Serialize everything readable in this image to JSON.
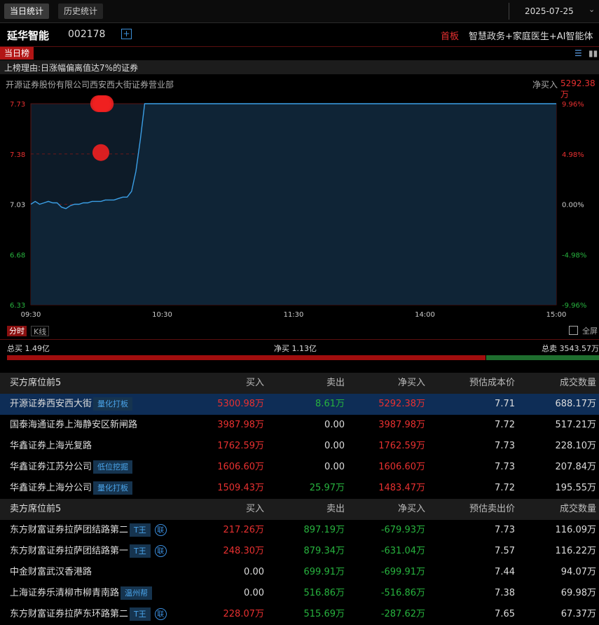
{
  "tabs": {
    "today": "当日统计",
    "history": "历史统计"
  },
  "date": "2025-07-25",
  "stock": {
    "name": "延华智能",
    "code": "002178",
    "add": "+",
    "first_board": "首板",
    "concepts": "智慧政务+家庭医生+AI智能体"
  },
  "board_tag": "当日榜",
  "reason": "上榜理由:日涨幅偏离值达7%的证券",
  "broker": "开源证券股份有限公司西安西大街证券营业部",
  "net_buy_label": "净买入",
  "net_buy_value": "5292.38万",
  "chart_data": {
    "type": "line",
    "title": "",
    "price_ticks": [
      "7.73",
      "7.38",
      "7.03",
      "6.68",
      "6.33"
    ],
    "pct_ticks": [
      "9.96%",
      "4.98%",
      "0.00%",
      "-4.98%",
      "-9.96%"
    ],
    "time_ticks": [
      "09:30",
      "10:30",
      "11:30",
      "14:00",
      "15:00"
    ],
    "ylim": [
      6.33,
      7.73
    ],
    "x_minutes": [
      0,
      2,
      4,
      6,
      8,
      10,
      12,
      14,
      16,
      18,
      20,
      22,
      24,
      26,
      28,
      30,
      32,
      34,
      36,
      38,
      40,
      42,
      44,
      46,
      48,
      50,
      52,
      54,
      56,
      58,
      60,
      240
    ],
    "prices": [
      7.03,
      7.05,
      7.03,
      7.04,
      7.05,
      7.04,
      7.04,
      7.01,
      7.0,
      7.02,
      7.03,
      7.03,
      7.04,
      7.04,
      7.05,
      7.05,
      7.05,
      7.06,
      7.06,
      7.06,
      7.07,
      7.08,
      7.08,
      7.12,
      7.26,
      7.48,
      7.73,
      7.73,
      7.73,
      7.73,
      7.73,
      7.73
    ],
    "markers": [
      {
        "x": 33,
        "price": 7.73
      },
      {
        "x": 32,
        "price": 7.73
      },
      {
        "x": 31,
        "price": 7.73
      },
      {
        "x": 34,
        "price": 7.73
      },
      {
        "x": 32,
        "price": 7.39
      }
    ]
  },
  "period_tabs": {
    "fenshi": "分时",
    "kline": "K线"
  },
  "fullscreen": "全屏",
  "summary": {
    "total_buy": "总买 1.49亿",
    "net": "净买 1.13亿",
    "total_sell": "总卖 3543.57万"
  },
  "ratio": {
    "buy_share": 0.808
  },
  "buy_table": {
    "headers": [
      "买方席位前5",
      "买入",
      "卖出",
      "净买入",
      "预估成本价",
      "成交数量"
    ],
    "rows": [
      {
        "name": "开源证券西安西大街",
        "tag": "量化打板",
        "buy": "5300.98万",
        "sell": "8.61万",
        "net": "5292.38万",
        "cost": "7.71",
        "vol": "688.17万"
      },
      {
        "name": "国泰海通证券上海静安区新闸路",
        "tag": "",
        "buy": "3987.98万",
        "sell": "0.00",
        "net": "3987.98万",
        "cost": "7.72",
        "vol": "517.21万"
      },
      {
        "name": "华鑫证券上海光复路",
        "tag": "",
        "buy": "1762.59万",
        "sell": "0.00",
        "net": "1762.59万",
        "cost": "7.73",
        "vol": "228.10万"
      },
      {
        "name": "华鑫证券江苏分公司",
        "tag": "低位挖掘",
        "buy": "1606.60万",
        "sell": "0.00",
        "net": "1606.60万",
        "cost": "7.73",
        "vol": "207.84万"
      },
      {
        "name": "华鑫证券上海分公司",
        "tag": "量化打板",
        "buy": "1509.43万",
        "sell": "25.97万",
        "net": "1483.47万",
        "cost": "7.72",
        "vol": "195.55万"
      }
    ]
  },
  "sell_table": {
    "headers": [
      "卖方席位前5",
      "买入",
      "卖出",
      "净买入",
      "预估卖出价",
      "成交数量"
    ],
    "rows": [
      {
        "name": "东方财富证券拉萨团结路第二",
        "tag": "T王",
        "lian": "联",
        "buy": "217.26万",
        "sell": "897.19万",
        "net": "-679.93万",
        "cost": "7.73",
        "vol": "116.09万"
      },
      {
        "name": "东方财富证券拉萨团结路第一",
        "tag": "T王",
        "lian": "联",
        "buy": "248.30万",
        "sell": "879.34万",
        "net": "-631.04万",
        "cost": "7.57",
        "vol": "116.22万"
      },
      {
        "name": "中金财富武汉香港路",
        "tag": "",
        "lian": "",
        "buy": "0.00",
        "sell": "699.91万",
        "net": "-699.91万",
        "cost": "7.44",
        "vol": "94.07万"
      },
      {
        "name": "上海证券乐清柳市柳青南路",
        "tag": "温州帮",
        "lian": "",
        "buy": "0.00",
        "sell": "516.86万",
        "net": "-516.86万",
        "cost": "7.38",
        "vol": "69.98万"
      },
      {
        "name": "东方财富证券拉萨东环路第二",
        "tag": "T王",
        "lian": "联",
        "buy": "228.07万",
        "sell": "515.69万",
        "net": "-287.62万",
        "cost": "7.65",
        "vol": "67.37万"
      }
    ]
  }
}
